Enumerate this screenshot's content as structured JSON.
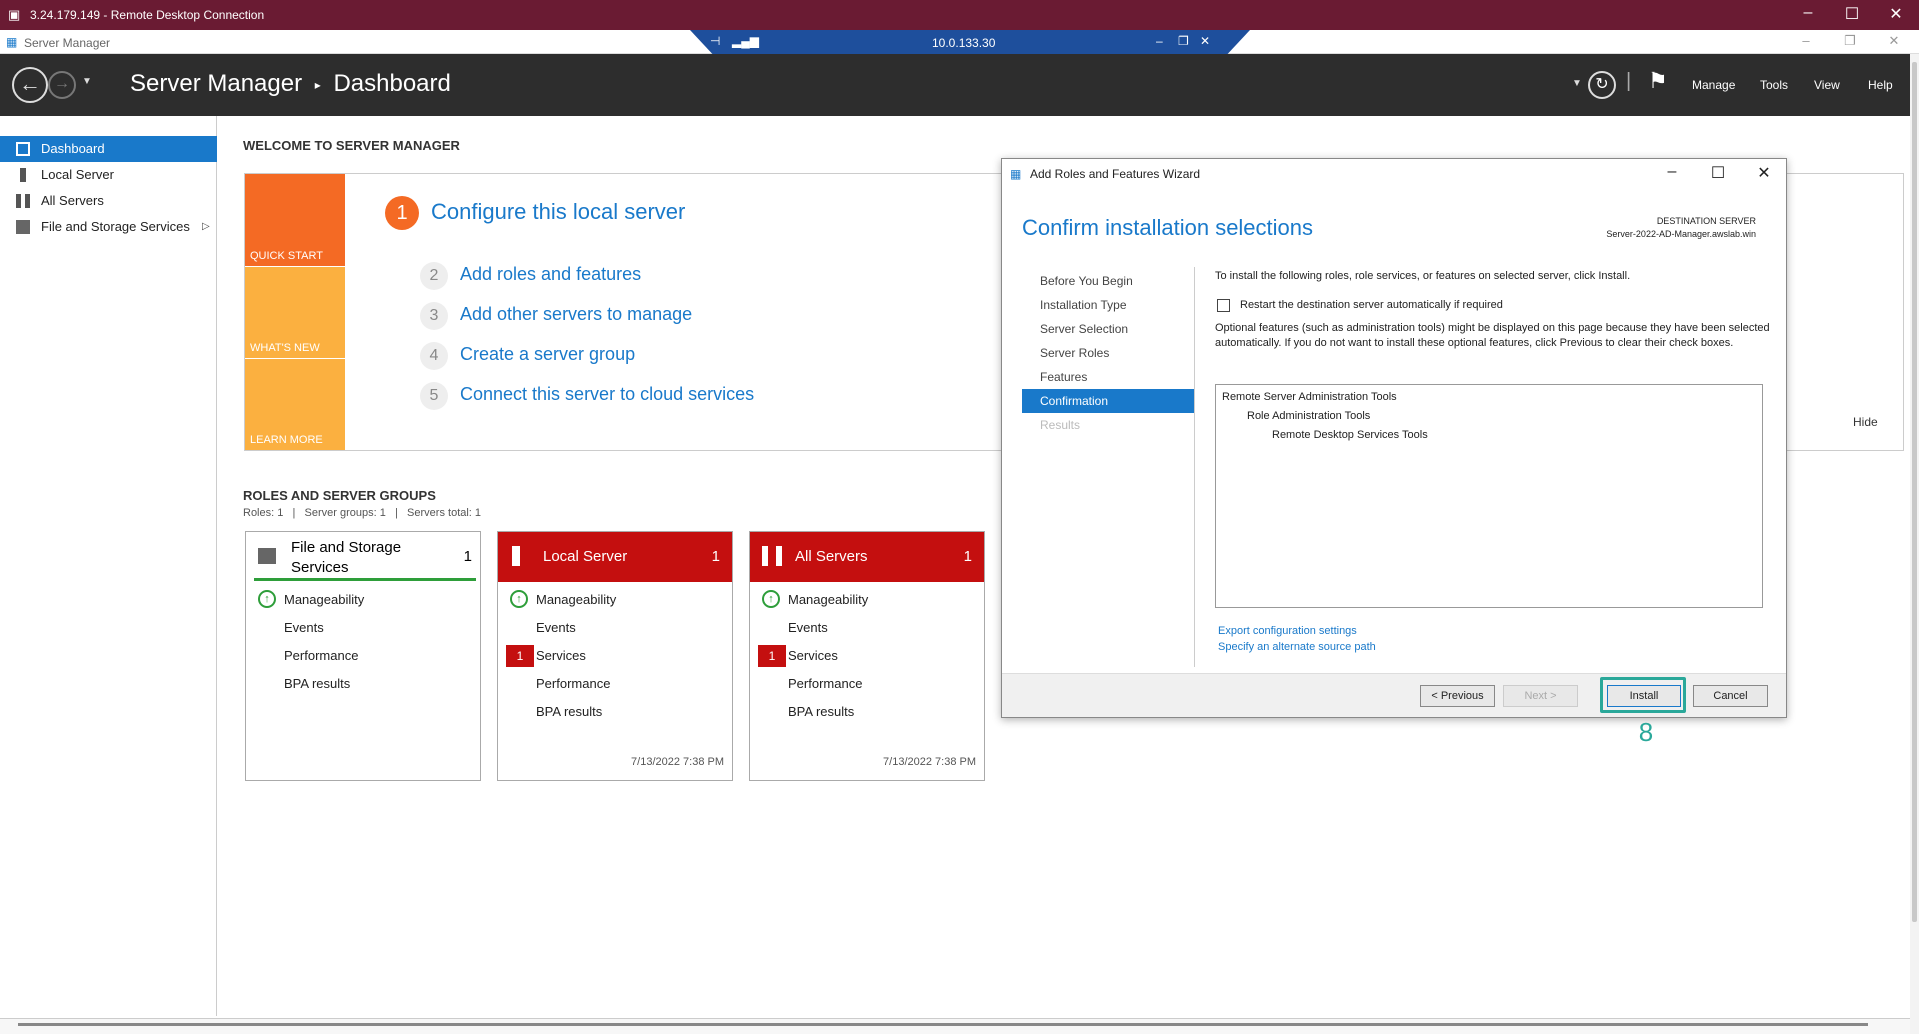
{
  "rdp": {
    "title": "3.24.179.149 - Remote Desktop Connection",
    "connection_ip": "10.0.133.30"
  },
  "inner_window": {
    "title": "Server Manager"
  },
  "header": {
    "app": "Server Manager",
    "separator": "▸",
    "page": "Dashboard",
    "menu": {
      "manage": "Manage",
      "tools": "Tools",
      "view": "View",
      "help": "Help"
    }
  },
  "sidebar": {
    "items": [
      {
        "label": "Dashboard"
      },
      {
        "label": "Local Server"
      },
      {
        "label": "All Servers"
      },
      {
        "label": "File and Storage Services"
      }
    ]
  },
  "welcome": {
    "title": "WELCOME TO SERVER MANAGER",
    "tiles": {
      "quick_start": "QUICK START",
      "whats_new": "WHAT'S NEW",
      "learn_more": "LEARN MORE"
    },
    "steps": [
      {
        "num": "1",
        "label": "Configure this local server"
      },
      {
        "num": "2",
        "label": "Add roles and features"
      },
      {
        "num": "3",
        "label": "Add other servers to manage"
      },
      {
        "num": "4",
        "label": "Create a server group"
      },
      {
        "num": "5",
        "label": "Connect this server to cloud services"
      }
    ],
    "hide": "Hide"
  },
  "roles": {
    "title": "ROLES AND SERVER GROUPS",
    "summary": "Roles: 1   |   Server groups: 1   |   Servers total: 1",
    "tiles": [
      {
        "name": "File and Storage Services",
        "count": "1",
        "rows": [
          "Manageability",
          "Events",
          "Performance",
          "BPA results"
        ]
      },
      {
        "name": "Local Server",
        "count": "1",
        "rows": [
          "Manageability",
          "Events",
          "Services",
          "Performance",
          "BPA results"
        ],
        "services_badge": "1",
        "timestamp": "7/13/2022 7:38 PM"
      },
      {
        "name": "All Servers",
        "count": "1",
        "rows": [
          "Manageability",
          "Events",
          "Services",
          "Performance",
          "BPA results"
        ],
        "services_badge": "1",
        "timestamp": "7/13/2022 7:38 PM"
      }
    ]
  },
  "wizard": {
    "title": "Add Roles and Features Wizard",
    "heading": "Confirm installation selections",
    "dest_label": "DESTINATION SERVER",
    "dest_server": "Server-2022-AD-Manager.awslab.win",
    "steps": [
      "Before You Begin",
      "Installation Type",
      "Server Selection",
      "Server Roles",
      "Features",
      "Confirmation",
      "Results"
    ],
    "intro": "To install the following roles, role services, or features on selected server, click Install.",
    "restart_label": "Restart the destination server automatically if required",
    "optional_note": "Optional features (such as administration tools) might be displayed on this page because they have been selected automatically. If you do not want to install these optional features, click Previous to clear their check boxes.",
    "list": [
      "Remote Server Administration Tools",
      "Role Administration Tools",
      "Remote Desktop Services Tools"
    ],
    "links": {
      "export": "Export configuration settings",
      "alternate": "Specify an alternate source path"
    },
    "buttons": {
      "previous": "< Previous",
      "next": "Next >",
      "install": "Install",
      "cancel": "Cancel"
    }
  },
  "annotation": {
    "step_number": "8"
  },
  "colors": {
    "accent": "#1979ca",
    "alert_red": "#c40f0f",
    "highlight": "#2aa89a",
    "rdp_bar": "#6a1b33"
  }
}
